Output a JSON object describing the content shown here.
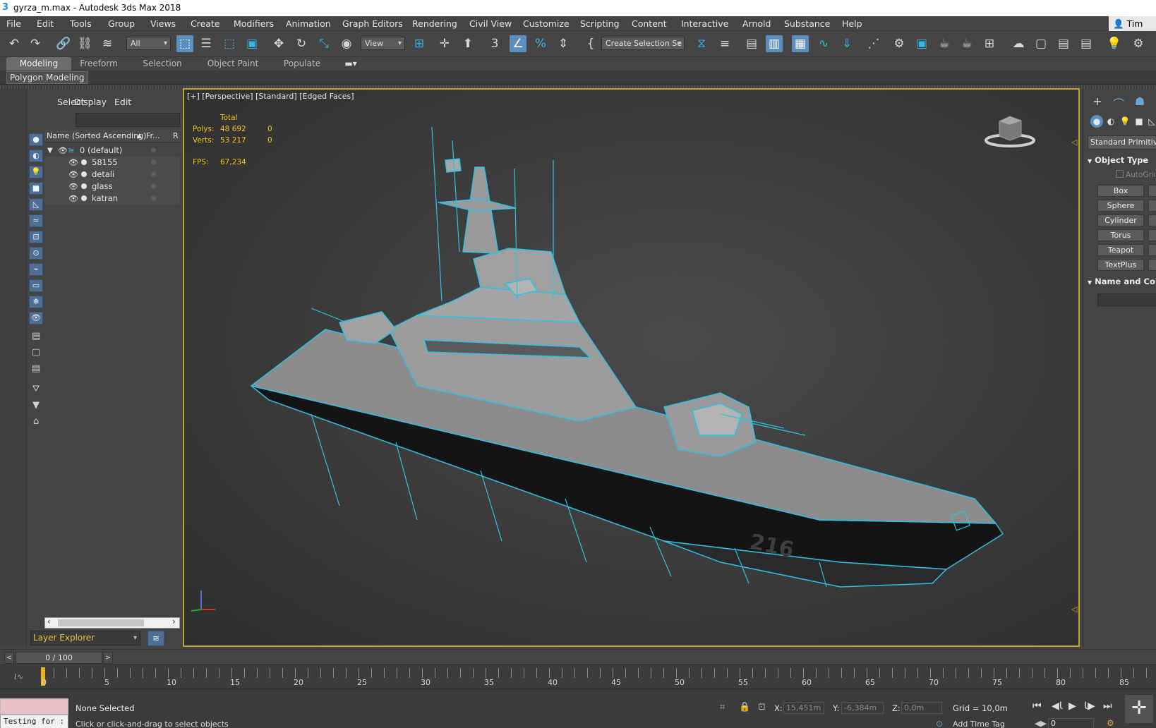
{
  "window": {
    "title": "gyrza_m.max - Autodesk 3ds Max 2018"
  },
  "menu": {
    "items": [
      "File",
      "Edit",
      "Tools",
      "Group",
      "Views",
      "Create",
      "Modifiers",
      "Animation",
      "Graph Editors",
      "Rendering",
      "Civil View",
      "Customize",
      "Scripting",
      "Content",
      "Interactive",
      "Arnold",
      "Substance",
      "Help"
    ],
    "user": "Tim Sa"
  },
  "toolbar": {
    "filter_select": "All",
    "view_select": "View",
    "selection_set": "Create Selection Se",
    "snap_label": "3"
  },
  "ribbon": {
    "tabs": [
      "Modeling",
      "Freeform",
      "Selection",
      "Object Paint",
      "Populate"
    ],
    "active": "Modeling",
    "sub_label": "Polygon Modeling"
  },
  "scene_explorer": {
    "tabs": [
      "Select",
      "Display",
      "Edit"
    ],
    "col_name": "Name (Sorted Ascending)",
    "col_sort": "▲",
    "col_frozen": "Fr...",
    "col_r": "R",
    "root_layer": "0 (default)",
    "objects": [
      "58155",
      "detali",
      "glass",
      "katran"
    ],
    "explorer_type": "Layer Explorer"
  },
  "viewport": {
    "label": "[+] [Perspective] [Standard] [Edged Faces]",
    "stats": {
      "total_label": "Total",
      "polys_label": "Polys:",
      "polys_value": "48 692",
      "polys_sel": "0",
      "verts_label": "Verts:",
      "verts_value": "53 217",
      "verts_sel": "0",
      "fps_label": "FPS:",
      "fps_value": "67,234"
    },
    "hull_number": "216",
    "wire_color": "#2fc1e0"
  },
  "command_panel": {
    "category": "Standard Primitives",
    "object_type_title": "Object Type",
    "autogrid": "AutoGrid",
    "primitives": [
      "Box",
      "Sphere",
      "Cylinder",
      "Torus",
      "Teapot",
      "TextPlus"
    ],
    "name_color_title": "Name and Col"
  },
  "timeline": {
    "slider_value": "0 / 100",
    "ticks": [
      "0",
      "5",
      "10",
      "15",
      "20",
      "25",
      "30",
      "35",
      "40",
      "45",
      "50",
      "55",
      "60",
      "65",
      "70",
      "75",
      "80",
      "85"
    ]
  },
  "status": {
    "maxscript_text": "Testing for :",
    "selection": "None Selected",
    "prompt": "Click or click-and-drag to select objects",
    "x_label": "X:",
    "x_value": "15,451m",
    "y_label": "Y:",
    "y_value": "-6,384m",
    "z_label": "Z:",
    "z_value": "0,0m",
    "grid": "Grid = 10,0m",
    "add_time_tag": "Add Time Tag",
    "frame_value": "0"
  }
}
